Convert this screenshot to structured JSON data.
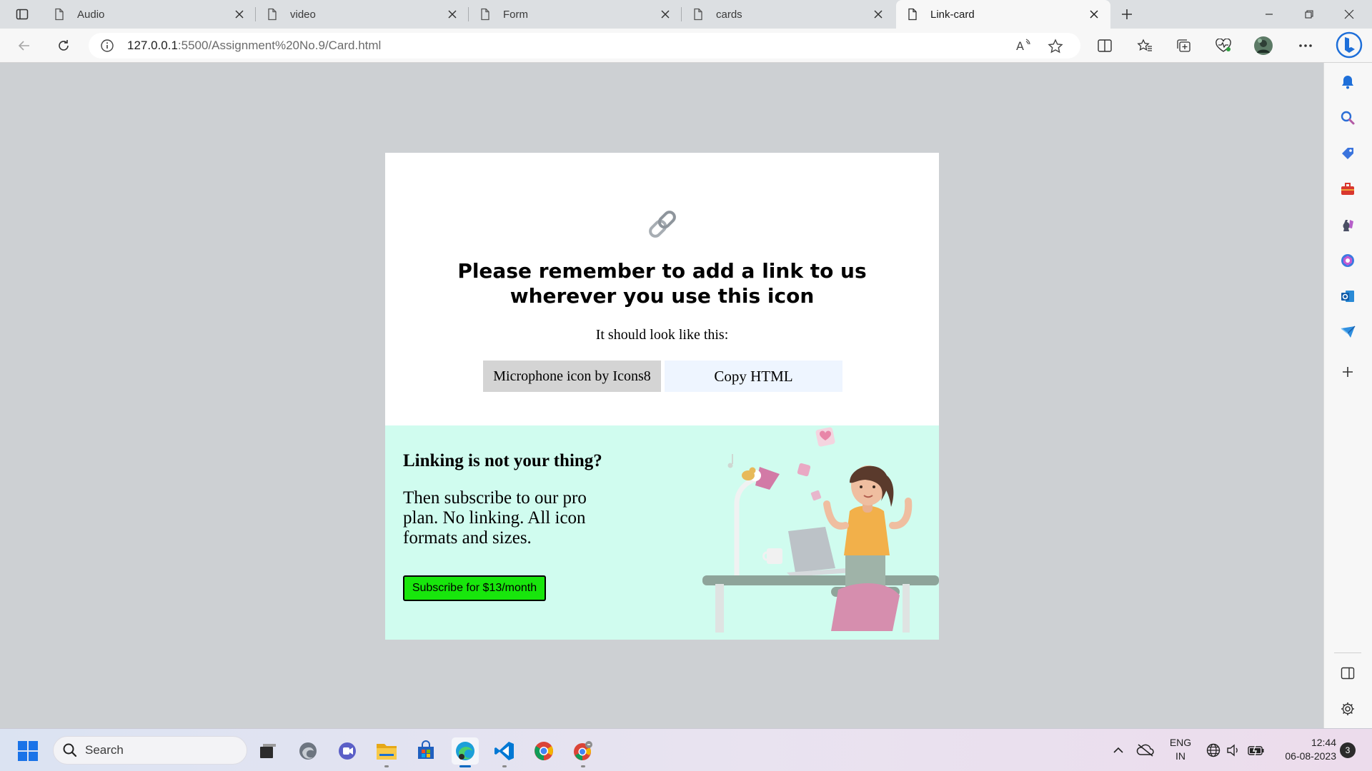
{
  "browser": {
    "tabs": [
      {
        "title": "Audio",
        "active": false
      },
      {
        "title": "video",
        "active": false
      },
      {
        "title": "Form",
        "active": false
      },
      {
        "title": "cards",
        "active": false
      },
      {
        "title": "Link-card",
        "active": true
      }
    ],
    "url_host": "127.0.0.1",
    "url_rest": ":5500/Assignment%20No.9/Card.html",
    "toolbar_icons": [
      "back-icon",
      "refresh-icon",
      "site-info-icon",
      "read-aloud-icon",
      "favorite-star-icon",
      "split-screen-icon",
      "favorites-icon",
      "collections-icon",
      "browser-essentials-icon",
      "profile-avatar",
      "more-icon",
      "bing-copilot-icon"
    ],
    "sidebar_icons": [
      "bell-icon",
      "search-icon",
      "shopping-tag-icon",
      "tools-icon",
      "games-icon",
      "office-icon",
      "outlook-icon",
      "send-icon",
      "add-icon",
      "sidebar-toggle-icon",
      "settings-icon"
    ]
  },
  "card": {
    "emoji": "🔗",
    "title": "Please remember to add a link to us wherever you use this icon",
    "subtitle": "It should look like this:",
    "attribution_button": "Microphone icon by Icons8",
    "copy_button": "Copy HTML",
    "promo_title": "Linking is not your thing?",
    "promo_text": "Then subscribe to our pro plan. No linking. All icon formats and sizes.",
    "subscribe_button": "Subscribe for $13/month",
    "colors": {
      "promo_bg": "#d0fcef",
      "subscribe_bg": "#18e60c",
      "attribution_bg": "#d4d4d4",
      "copy_bg": "#eef5ff"
    }
  },
  "taskbar": {
    "search_label": "Search",
    "apps": [
      "start-icon",
      "task-view-icon",
      "edge-icon",
      "teams-chat-icon",
      "file-explorer-icon",
      "store-icon",
      "edge-dev-icon",
      "vscode-icon",
      "chrome-icon",
      "chrome-alt-icon"
    ],
    "lang_line1": "ENG",
    "lang_line2": "IN",
    "time": "12:44",
    "date": "06-08-2023",
    "notifications": "3"
  }
}
